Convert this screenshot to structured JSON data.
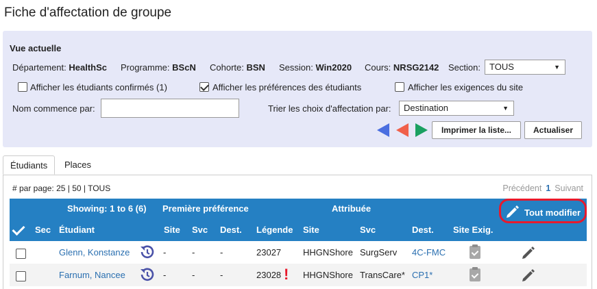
{
  "page": {
    "title": "Fiche d'affectation de groupe"
  },
  "view": {
    "heading": "Vue actuelle",
    "department_label": "Département:",
    "department_value": "HealthSc",
    "program_label": "Programme:",
    "program_value": "BScN",
    "cohort_label": "Cohorte:",
    "cohort_value": "BSN",
    "session_label": "Session:",
    "session_value": "Win2020",
    "course_label": "Cours:",
    "course_value": "NRSG2142",
    "section_label": "Section:",
    "section_value": "TOUS",
    "show_confirmed_label": "Afficher les étudiants confirmés (1)",
    "show_preferences_label": "Afficher les préférences des étudiants",
    "show_requirements_label": "Afficher les exigences du site",
    "name_starts_label": "Nom commence par:",
    "name_starts_value": "",
    "sort_label": "Trier les choix d'affectation par:",
    "sort_value": "Destination",
    "print_button": "Imprimer la liste...",
    "refresh_button": "Actualiser"
  },
  "tabs": [
    {
      "label": "Étudiants"
    },
    {
      "label": "Places"
    }
  ],
  "pagination": {
    "per_page_label": "# par page:",
    "per_page_options": "25 | 50 | TOUS",
    "prev": "Précédent",
    "current": "1",
    "next": "Suivant"
  },
  "table": {
    "showing": "Showing: 1 to 6 (6)",
    "first_pref": "Première préférence",
    "assigned": "Attribuée",
    "edit_all": "Tout modifier",
    "columns": {
      "sec": "Sec",
      "student": "Étudiant",
      "site": "Site",
      "svc": "Svc",
      "dest": "Dest.",
      "legend": "Légende",
      "a_site": "Site",
      "a_svc": "Svc",
      "a_dest": "Dest.",
      "site_req": "Site Exig."
    },
    "rows": [
      {
        "name": "Glenn, Konstanze",
        "site": "-",
        "svc": "-",
        "dest": "-",
        "legend": "23027",
        "a_site": "HHGNShore",
        "a_svc": "SurgServ",
        "a_dest": "4C-FMC"
      },
      {
        "name": "Farnum, Nancee",
        "site": "-",
        "svc": "-",
        "dest": "-",
        "legend": "23028",
        "a_site": "HHGNShore",
        "a_svc": "TransCare*",
        "a_dest": "CP1*"
      }
    ]
  },
  "colors": {
    "header_blue": "#2580c3",
    "panel_bg": "#e6e8f8",
    "highlight_red": "#e8192c",
    "link_blue": "#2a6fb0"
  }
}
